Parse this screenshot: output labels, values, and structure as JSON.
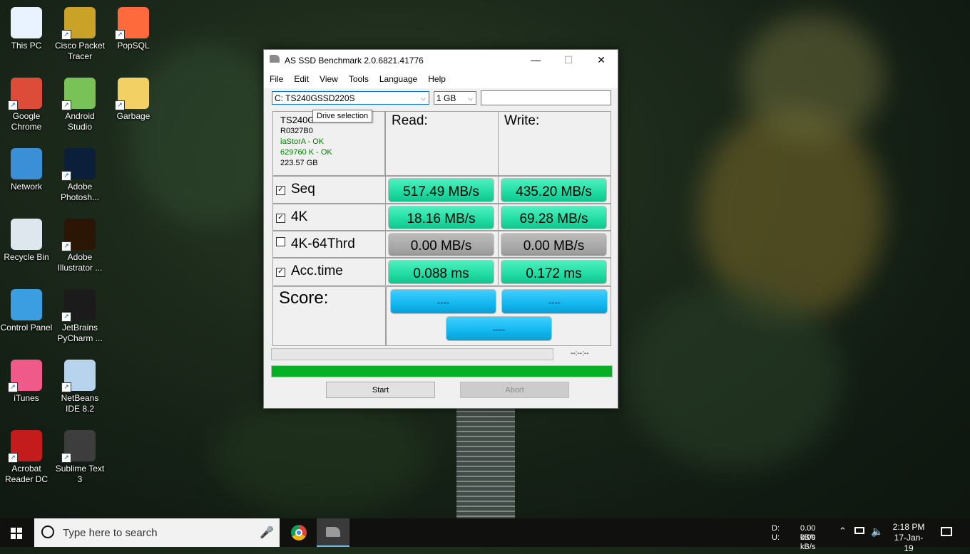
{
  "desktop": {
    "icons": [
      {
        "label": "This PC",
        "icon": "this-pc-icon"
      },
      {
        "label": "Cisco Packet Tracer",
        "icon": "cisco-packet-tracer-icon"
      },
      {
        "label": "PopSQL",
        "icon": "popsql-icon"
      },
      {
        "label": "Google Chrome",
        "icon": "chrome-icon"
      },
      {
        "label": "Android Studio",
        "icon": "android-studio-icon"
      },
      {
        "label": "Garbage",
        "icon": "folder-icon"
      },
      {
        "label": "Network",
        "icon": "network-icon"
      },
      {
        "label": "Adobe Photosh...",
        "icon": "photoshop-icon"
      },
      {
        "label": "Recycle Bin",
        "icon": "recycle-bin-icon"
      },
      {
        "label": "Adobe Illustrator ...",
        "icon": "illustrator-icon"
      },
      {
        "label": "Control Panel",
        "icon": "control-panel-icon"
      },
      {
        "label": "JetBrains PyCharm ...",
        "icon": "pycharm-icon"
      },
      {
        "label": "iTunes",
        "icon": "itunes-icon"
      },
      {
        "label": "NetBeans IDE 8.2",
        "icon": "netbeans-icon"
      },
      {
        "label": "Acrobat Reader DC",
        "icon": "acrobat-icon"
      },
      {
        "label": "Sublime Text 3",
        "icon": "sublime-text-icon"
      }
    ]
  },
  "window": {
    "title": "AS SSD Benchmark 2.0.6821.41776",
    "controls": {
      "minimize": "—",
      "maximize": "☐",
      "close": "✕"
    },
    "menu": [
      "File",
      "Edit",
      "View",
      "Tools",
      "Language",
      "Help"
    ],
    "drive_select": {
      "value": "C: TS240GSSD220S"
    },
    "size_select": {
      "value": "1 GB"
    },
    "text_field": {
      "value": ""
    },
    "tooltip": "Drive selection",
    "drive_info": {
      "model": "TS240G",
      "firmware": "R0327B0",
      "driver_status": "iaStorA - OK",
      "alignment_status": "629760 K - OK",
      "capacity": "223.57 GB"
    },
    "headers": {
      "read": "Read:",
      "write": "Write:",
      "score": "Score:"
    },
    "tests": [
      {
        "name": "Seq",
        "checked": true,
        "read": "517.49 MB/s",
        "write": "435.20 MB/s",
        "state": "done"
      },
      {
        "name": "4K",
        "checked": true,
        "read": "18.16 MB/s",
        "write": "69.28 MB/s",
        "state": "done"
      },
      {
        "name": "4K-64Thrd",
        "checked": false,
        "read": "0.00 MB/s",
        "write": "0.00 MB/s",
        "state": "skipped"
      },
      {
        "name": "Acc.time",
        "checked": true,
        "read": "0.088 ms",
        "write": "0.172 ms",
        "state": "done"
      }
    ],
    "scores": {
      "read": "----",
      "write": "----",
      "total": "----"
    },
    "elapsed": "--:--:--",
    "progress": 1.0,
    "buttons": {
      "start": "Start",
      "abort": "Abort"
    }
  },
  "taskbar": {
    "search_placeholder": "Type here to search",
    "apps": [
      {
        "icon": "chrome-icon"
      },
      {
        "icon": "as-ssd-icon"
      }
    ],
    "io": {
      "d_label": "D:",
      "u_label": "U:",
      "d_value": "0.00 kB/s",
      "u_value": "0.00 kB/s"
    },
    "time": "2:18 PM",
    "date": "17-Jan-19"
  },
  "colors": {
    "accent_green": "#1fdca3",
    "score_blue": "#12b7ef",
    "progress_green": "#06b025"
  }
}
